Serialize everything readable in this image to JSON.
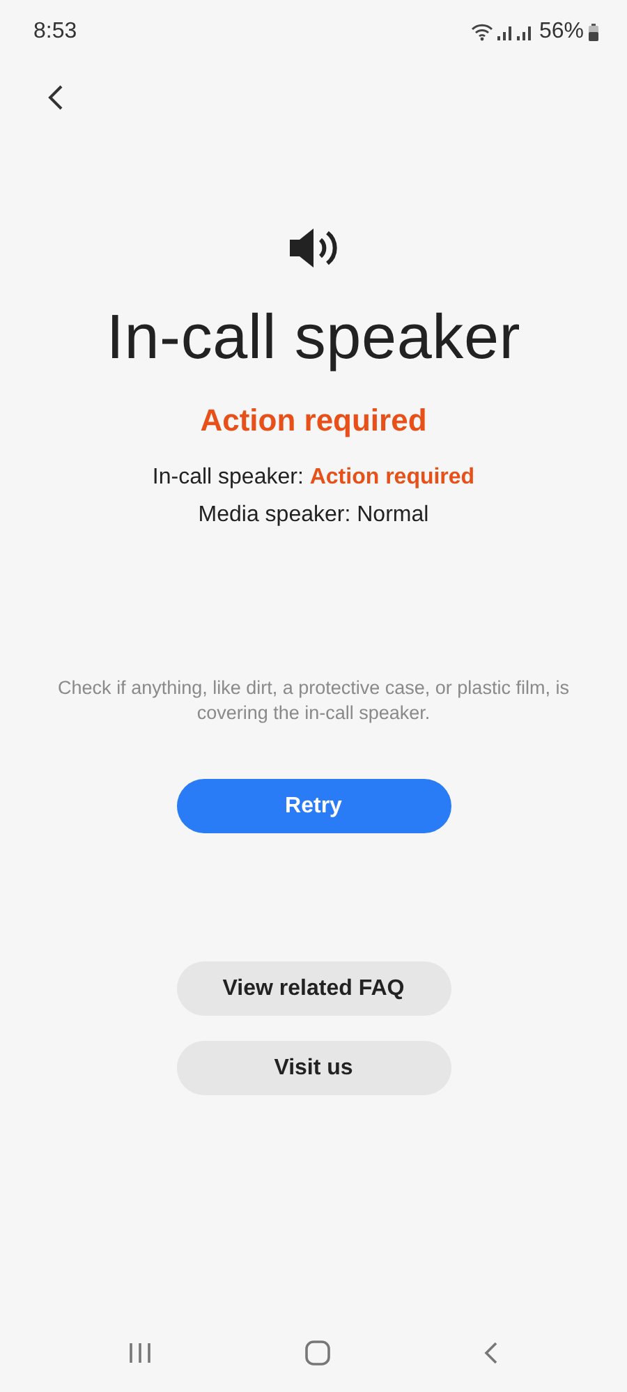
{
  "status_bar": {
    "time": "8:53",
    "battery": "56%"
  },
  "header": {
    "back": true
  },
  "title": "In-call speaker",
  "result": {
    "text": "Action required",
    "alert": true
  },
  "details": [
    {
      "label": "In-call speaker:",
      "value": "Action required",
      "alert": true
    },
    {
      "label": "Media speaker:",
      "value": "Normal",
      "alert": false
    }
  ],
  "hint": "Check if anything, like dirt, a protective case, or plastic film, is covering the in-call speaker.",
  "primary_button": "Retry",
  "secondary_buttons": [
    "View related FAQ",
    "Visit us"
  ]
}
